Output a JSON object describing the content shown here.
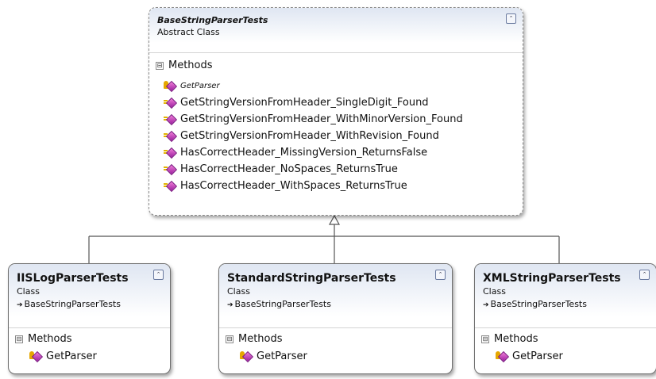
{
  "base": {
    "title": "BaseStringParserTests",
    "kind": "Abstract Class",
    "section_label": "Methods",
    "toggle_symbol": "⊟",
    "collapse_symbol": "⌃",
    "methods": [
      {
        "name": "GetParser",
        "style": "abstract"
      },
      {
        "name": "GetStringVersionFromHeader_SingleDigit_Found",
        "style": "public"
      },
      {
        "name": "GetStringVersionFromHeader_WithMinorVersion_Found",
        "style": "public"
      },
      {
        "name": "GetStringVersionFromHeader_WithRevision_Found",
        "style": "public"
      },
      {
        "name": "HasCorrectHeader_MissingVersion_ReturnsFalse",
        "style": "public"
      },
      {
        "name": "HasCorrectHeader_NoSpaces_ReturnsTrue",
        "style": "public"
      },
      {
        "name": "HasCorrectHeader_WithSpaces_ReturnsTrue",
        "style": "public"
      }
    ]
  },
  "derived": [
    {
      "title": "IISLogParserTests",
      "kind": "Class",
      "base_ref": "BaseStringParserTests",
      "inherit_arrow": "➔",
      "section_label": "Methods",
      "methods": [
        "GetParser"
      ]
    },
    {
      "title": "StandardStringParserTests",
      "kind": "Class",
      "base_ref": "BaseStringParserTests",
      "inherit_arrow": "➔",
      "section_label": "Methods",
      "methods": [
        "GetParser"
      ]
    },
    {
      "title": "XMLStringParserTests",
      "kind": "Class",
      "base_ref": "BaseStringParserTests",
      "inherit_arrow": "➔",
      "section_label": "Methods",
      "methods": [
        "GetParser"
      ]
    }
  ],
  "colors": {
    "header_gradient_top": "#dfe6f2",
    "connector": "#555555",
    "method_icon": "#b02aaf"
  }
}
